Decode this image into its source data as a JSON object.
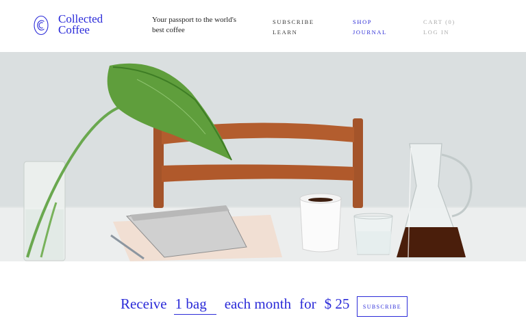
{
  "brand": {
    "name_line1": "Collected",
    "name_line2": "Coffee",
    "logo_icon": "cc-monogram-icon",
    "accent_color": "#2a2ad8"
  },
  "header": {
    "tagline": "Your passport to the world's best coffee"
  },
  "nav": {
    "col1": [
      "Subscribe",
      "Learn"
    ],
    "col2": [
      "Shop",
      "Journal"
    ],
    "col3": [
      "Cart (0)",
      "Log in"
    ]
  },
  "hero": {
    "image_alt": ""
  },
  "subscribe": {
    "word_receive": "Receive",
    "quantity": "1 bag",
    "word_each_month": "each month",
    "word_for": "for",
    "price": "$ 25",
    "button_label": "Subscribe"
  }
}
